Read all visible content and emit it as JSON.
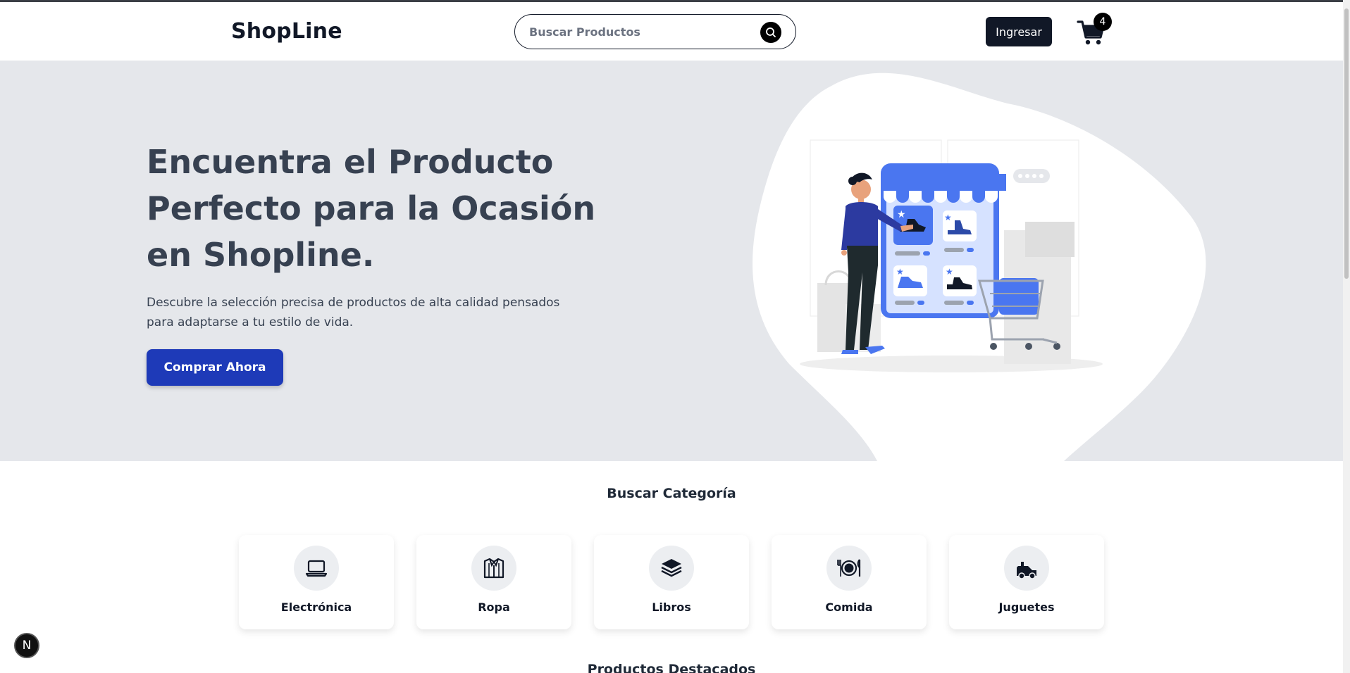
{
  "header": {
    "logo": "ShopLine",
    "search_placeholder": "Buscar Productos",
    "login_label": "Ingresar",
    "cart_count": "4"
  },
  "hero": {
    "title": "Encuentra el Producto Perfecto para la Ocasión en Shopline.",
    "description": "Descubre la selección precisa de productos de alta calidad pensados para adaptarse a tu estilo de vida.",
    "cta_label": "Comprar Ahora"
  },
  "categories": {
    "title": "Buscar Categoría",
    "items": [
      {
        "label": "Electrónica",
        "icon": "laptop-icon"
      },
      {
        "label": "Ropa",
        "icon": "shirt-icon"
      },
      {
        "label": "Libros",
        "icon": "book-stack-icon"
      },
      {
        "label": "Comida",
        "icon": "plate-cutlery-icon"
      },
      {
        "label": "Juguetes",
        "icon": "toy-car-icon"
      }
    ]
  },
  "next_section_title": "Productos Destacados",
  "dev_badge": "N",
  "colors": {
    "primary": "#1e3ab8",
    "dark": "#111827",
    "hero_bg": "#e5e7eb",
    "illustration_blue": "#4a76f0"
  }
}
